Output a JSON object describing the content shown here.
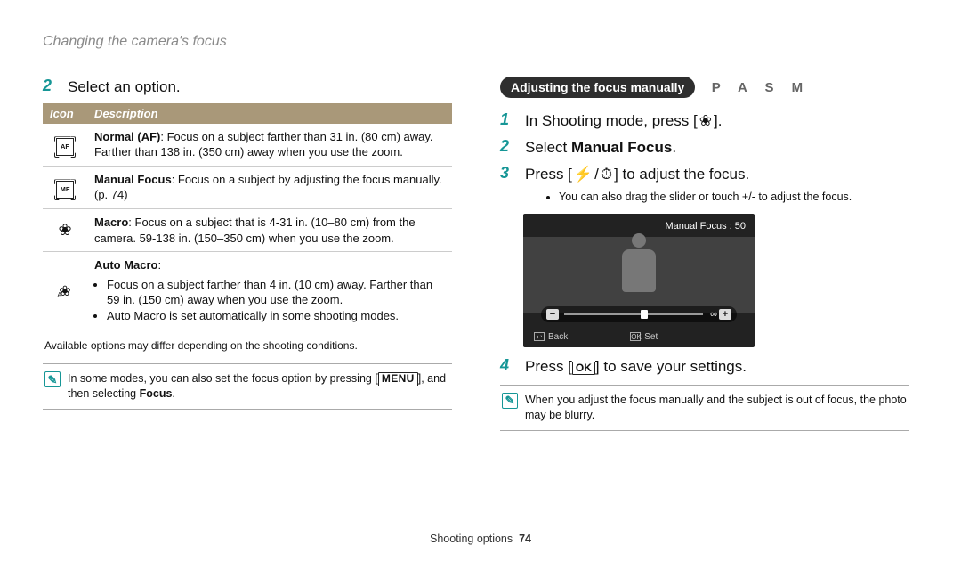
{
  "header_title": "Changing the camera's focus",
  "left": {
    "step_num": "2",
    "step_text": "Select an option.",
    "table": {
      "h_icon": "Icon",
      "h_desc": "Description",
      "rows": [
        {
          "icon_name": "af-icon",
          "icon_inner": "AF",
          "desc_bold": "Normal (AF)",
          "desc_rest": ": Focus on a subject farther than 31 in. (80 cm) away. Farther than 138 in. (350 cm) away when you use the zoom."
        },
        {
          "icon_name": "mf-icon",
          "icon_inner": "MF",
          "desc_bold": "Manual Focus",
          "desc_rest": ": Focus on a subject by adjusting the focus manually. (p. 74)"
        },
        {
          "icon_name": "macro-icon",
          "icon_inner": "❀",
          "desc_bold": "Macro",
          "desc_rest": ": Focus on a subject that is 4-31 in. (10–80 cm) from the camera. 59-138 in. (150–350 cm) when you use the zoom."
        },
        {
          "icon_name": "auto-macro-icon",
          "icon_inner": "❀",
          "icon_sub": "A",
          "desc_bold": "Auto Macro",
          "desc_rest": ":",
          "bullets": [
            "Focus on a subject farther than 4 in. (10 cm) away. Farther than 59 in. (150 cm) away when you use the zoom.",
            "Auto Macro is set automatically in some shooting modes."
          ]
        }
      ]
    },
    "note": "Available options may differ depending on the shooting conditions.",
    "tip_pre": "In some modes, you can also set the focus option by pressing [",
    "tip_btn": "MENU",
    "tip_mid": "], and then selecting ",
    "tip_bold": "Focus",
    "tip_end": "."
  },
  "right": {
    "section_label": "Adjusting the focus manually",
    "pasm": "P A S M",
    "steps": {
      "s1_num": "1",
      "s1_pre": "In Shooting mode, press [",
      "s1_glyph": "❀",
      "s1_post": "].",
      "s2_num": "2",
      "s2_pre": "Select ",
      "s2_bold": "Manual Focus",
      "s2_post": ".",
      "s3_num": "3",
      "s3_pre": "Press [",
      "s3_g1": "⚡",
      "s3_sep": "/",
      "s3_g2": "⏱",
      "s3_post": "] to adjust the focus.",
      "s3_sub": "You can also drag the slider or touch +/- to adjust the focus.",
      "s4_num": "4",
      "s4_pre": "Press [",
      "s4_btn": "OK",
      "s4_post": "] to save your settings."
    },
    "screen": {
      "label": "Manual Focus : 50",
      "minus": "−",
      "plus": "+",
      "inf": "∞",
      "back_label": "Back",
      "set_label": "Set",
      "back_btn": "↩",
      "ok_btn": "OK"
    },
    "tip": "When you adjust the focus manually and the subject is out of focus, the photo may be blurry."
  },
  "pager": {
    "section": "Shooting options",
    "num": "74"
  }
}
